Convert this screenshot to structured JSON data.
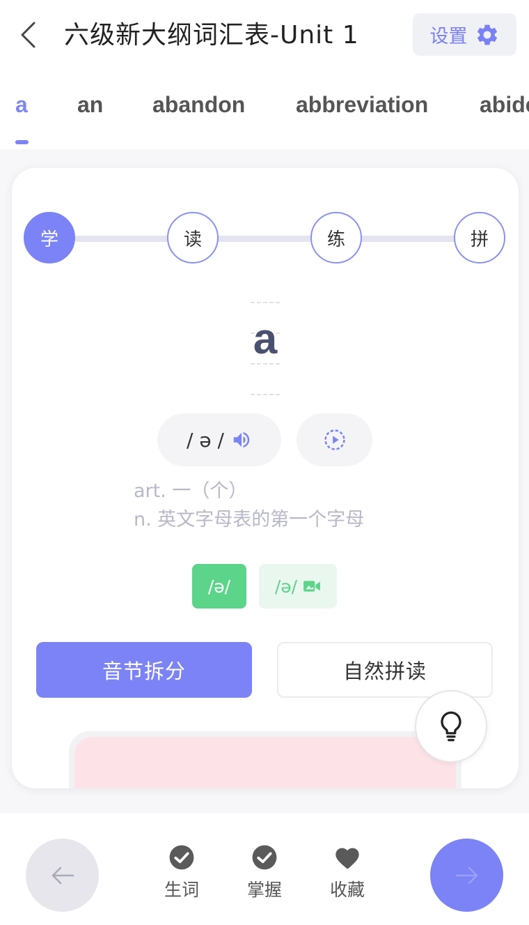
{
  "header": {
    "title": "六级新大纲词汇表-Unit 1",
    "settings_label": "设置"
  },
  "tabs": [
    {
      "label": "a",
      "active": true
    },
    {
      "label": "an",
      "active": false
    },
    {
      "label": "abandon",
      "active": false
    },
    {
      "label": "abbreviation",
      "active": false
    },
    {
      "label": "abide",
      "active": false
    }
  ],
  "steps": [
    {
      "label": "学",
      "active": true
    },
    {
      "label": "读",
      "active": false
    },
    {
      "label": "练",
      "active": false
    },
    {
      "label": "拼",
      "active": false
    }
  ],
  "word": {
    "text": "a",
    "phonetic": "/ ə /",
    "definitions": [
      "art. 一（个）",
      "n. 英文字母表的第一个字母"
    ]
  },
  "phonics": {
    "tag_1": "/ə/",
    "tag_2": "/ə/"
  },
  "actions": {
    "syllable_split": "音节拆分",
    "natural_phonics": "自然拼读"
  },
  "bottom_bar": {
    "new_word": "生词",
    "mastered": "掌握",
    "favorite": "收藏"
  },
  "colors": {
    "accent": "#7b83f6",
    "green": "#5cd48a",
    "pink": "#fde3e7"
  }
}
